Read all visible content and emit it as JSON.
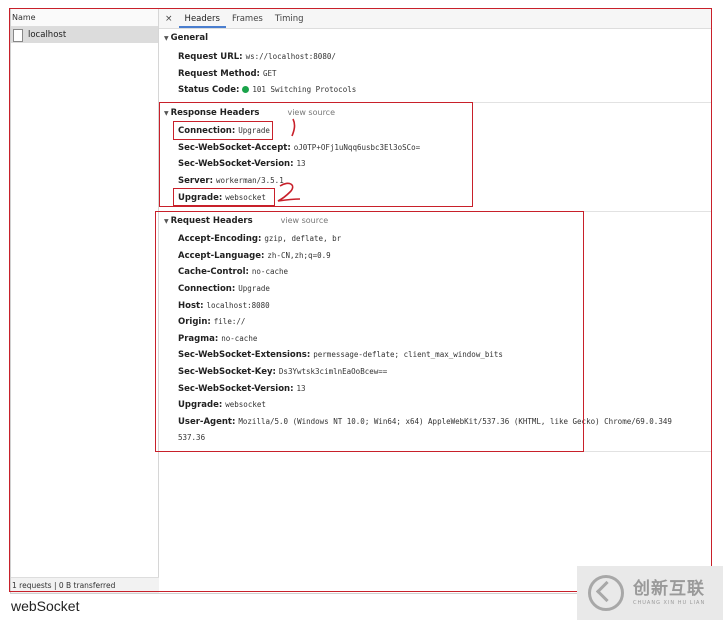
{
  "list": {
    "column_header": "Name",
    "request_name": "localhost",
    "footer": "1 requests  |  0 B transferred"
  },
  "tabs": {
    "close": "×",
    "items": [
      "Headers",
      "Frames",
      "Timing"
    ],
    "active": "Headers"
  },
  "general": {
    "title": "General",
    "rows": [
      {
        "key": "Request URL:",
        "value": "ws://localhost:8080/"
      },
      {
        "key": "Request Method:",
        "value": "GET"
      },
      {
        "key": "Status Code:",
        "value": "101 Switching Protocols"
      }
    ],
    "status_color": "#1aa34a"
  },
  "response_headers": {
    "title": "Response Headers",
    "view_source": "view source",
    "rows": [
      {
        "key": "Connection:",
        "value": "Upgrade"
      },
      {
        "key": "Sec-WebSocket-Accept:",
        "value": "oJ0TP+OFj1uNqq6usbc3El3oSCo="
      },
      {
        "key": "Sec-WebSocket-Version:",
        "value": "13"
      },
      {
        "key": "Server:",
        "value": "workerman/3.5.1"
      },
      {
        "key": "Upgrade:",
        "value": "websocket"
      }
    ]
  },
  "request_headers": {
    "title": "Request Headers",
    "view_source": "view source",
    "rows": [
      {
        "key": "Accept-Encoding:",
        "value": "gzip, deflate, br"
      },
      {
        "key": "Accept-Language:",
        "value": "zh-CN,zh;q=0.9"
      },
      {
        "key": "Cache-Control:",
        "value": "no-cache"
      },
      {
        "key": "Connection:",
        "value": "Upgrade"
      },
      {
        "key": "Host:",
        "value": "localhost:8080"
      },
      {
        "key": "Origin:",
        "value": "file://"
      },
      {
        "key": "Pragma:",
        "value": "no-cache"
      },
      {
        "key": "Sec-WebSocket-Extensions:",
        "value": "permessage-deflate; client_max_window_bits"
      },
      {
        "key": "Sec-WebSocket-Key:",
        "value": "Ds3Ywtsk3cimlnEaOoBcew=="
      },
      {
        "key": "Sec-WebSocket-Version:",
        "value": "13"
      },
      {
        "key": "Upgrade:",
        "value": "websocket"
      },
      {
        "key": "User-Agent:",
        "value": "Mozilla/5.0 (Windows NT 10.0; Win64; x64) AppleWebKit/537.36 (KHTML, like Gecko) Chrome/69.0.349"
      }
    ],
    "user_agent_wrap": "537.36"
  },
  "annotations": {
    "mark_1": "1",
    "mark_2": "2",
    "color": "#c8202a"
  },
  "caption": "webSocket",
  "watermark": {
    "cn": "创新互联",
    "en": "CHUANG XIN HU LIAN"
  }
}
